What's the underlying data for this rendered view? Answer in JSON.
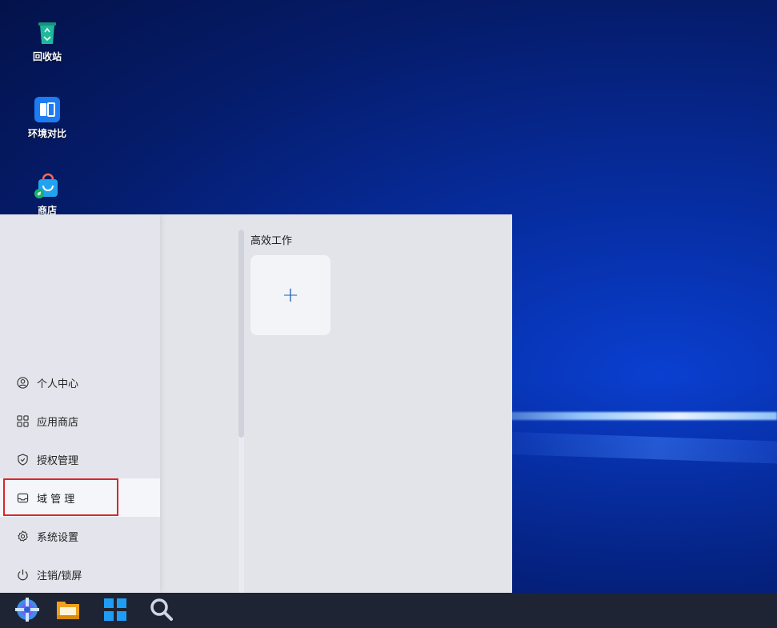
{
  "desktop": {
    "icons": [
      {
        "label": "回收站",
        "icon": "recycle-bin-icon"
      },
      {
        "label": "环境对比",
        "icon": "compare-icon"
      },
      {
        "label": "商店",
        "icon": "store-icon"
      }
    ]
  },
  "start_menu": {
    "items": [
      {
        "label": "个人中心",
        "icon": "user-circle-icon"
      },
      {
        "label": "应用商店",
        "icon": "grid-apps-icon"
      },
      {
        "label": "授权管理",
        "icon": "shield-icon"
      },
      {
        "label": "域 管 理",
        "icon": "inbox-icon"
      },
      {
        "label": "系统设置",
        "icon": "gear-icon"
      },
      {
        "label": "注销/锁屏",
        "icon": "power-icon"
      }
    ],
    "active_index": 3,
    "group_title": "高效工作",
    "add_tile_label": "+"
  },
  "taskbar": {
    "icons": [
      "start-logo-icon",
      "file-manager-icon",
      "app-grid-icon",
      "search-icon"
    ]
  },
  "colors": {
    "highlight": "#d9262b",
    "accent": "#1d5fb0"
  }
}
